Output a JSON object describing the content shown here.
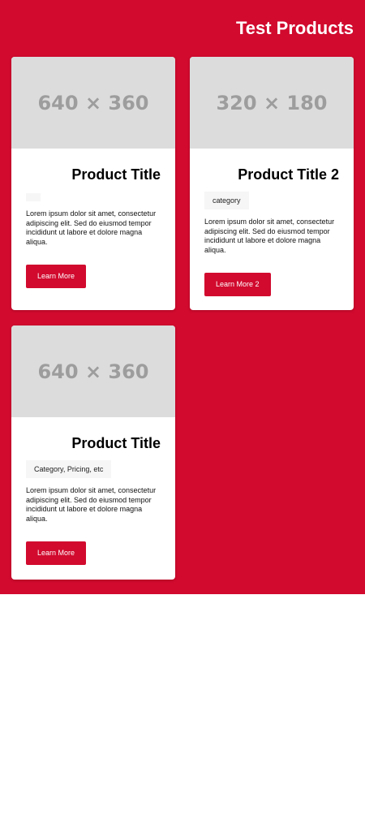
{
  "section": {
    "title": "Test Products",
    "background": "#d10a2e"
  },
  "products": [
    {
      "image_placeholder": "640 × 360",
      "title": "Product Title",
      "tag": "",
      "description": "Lorem ipsum dolor sit amet, consectetur adipiscing elit. Sed do eiusmod tempor incididunt ut labore et dolore magna aliqua.",
      "button_label": "Learn More"
    },
    {
      "image_placeholder": "320 × 180",
      "title": "Product Title 2",
      "tag": "category",
      "description": "Lorem ipsum dolor sit amet, consectetur adipiscing elit. Sed do eiusmod tempor incididunt ut labore et dolore magna aliqua.",
      "button_label": "Learn More 2"
    },
    {
      "image_placeholder": "640 × 360",
      "title": "Product Title",
      "tag": "Category, Pricing, etc",
      "description": "Lorem ipsum dolor sit amet, consectetur adipiscing elit. Sed do eiusmod tempor incididunt ut labore et dolore magna aliqua.",
      "button_label": "Learn More"
    }
  ]
}
